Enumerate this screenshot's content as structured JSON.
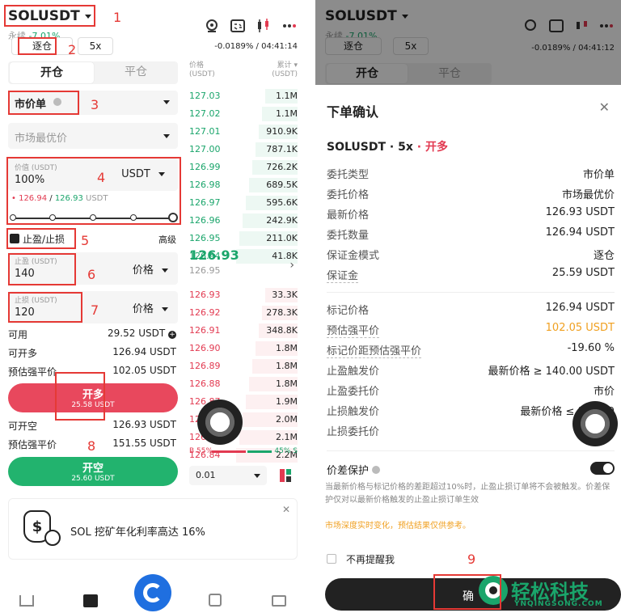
{
  "left": {
    "symbol": "SOLUSDT",
    "contract_type": "永续",
    "change_pct": "-7.01%",
    "funding_label": "资金费率/倒计时",
    "funding_value": "-0.0189% / 04:41:14",
    "margin_mode": "逐仓",
    "leverage": "5x",
    "tab_open": "开仓",
    "tab_close": "平仓",
    "order_type": "市价单",
    "market_best_price": "市场最优价",
    "value_label": "价值 (USDT)",
    "value_amount": "100%",
    "value_unit": "USDT",
    "price_bid": "126.94",
    "price_ask": "126.93",
    "price_suffix": "USDT",
    "tpsl_label": "止盈/止损",
    "advanced_label": "高级",
    "tp_label": "止盈 (USDT)",
    "tp_value": "140",
    "tp_type": "价格",
    "sl_label": "止损 (USDT)",
    "sl_value": "120",
    "sl_type": "价格",
    "available_label": "可用",
    "available_value": "29.52 USDT",
    "can_long_label": "可开多",
    "can_long_value": "126.94 USDT",
    "liq_label": "预估强平价",
    "liq_long_value": "102.05 USDT",
    "open_long_label": "开多",
    "open_long_sub": "25.58 USDT",
    "can_short_label": "可开空",
    "can_short_value": "126.93 USDT",
    "liq_short_value": "151.55 USDT",
    "open_short_label": "开空",
    "open_short_sub": "25.60 USDT",
    "ob_price_header": "价格\n(USDT)",
    "ob_total_header": "累计 ▾\n(USDT)",
    "ob_price_head1": "价格",
    "ob_price_head2": "(USDT)",
    "ob_total_head1": "累计 ▾",
    "ob_total_head2": "(USDT)",
    "asks_green": [
      {
        "price": "127.03",
        "total": "1.1M"
      },
      {
        "price": "127.02",
        "total": "1.1M"
      },
      {
        "price": "127.01",
        "total": "910.9K"
      },
      {
        "price": "127.00",
        "total": "787.1K"
      },
      {
        "price": "126.99",
        "total": "726.2K"
      },
      {
        "price": "126.98",
        "total": "689.5K"
      },
      {
        "price": "126.97",
        "total": "595.6K"
      },
      {
        "price": "126.96",
        "total": "242.9K"
      },
      {
        "price": "126.95",
        "total": "211.0K"
      },
      {
        "price": "126.94",
        "total": "41.8K"
      }
    ],
    "last_price": "126.93",
    "mark_price": "126.95",
    "bids_red": [
      {
        "price": "126.93",
        "total": "33.3K"
      },
      {
        "price": "126.92",
        "total": "278.3K"
      },
      {
        "price": "126.91",
        "total": "348.8K"
      },
      {
        "price": "126.90",
        "total": "1.8M"
      },
      {
        "price": "126.89",
        "total": "1.8M"
      },
      {
        "price": "126.88",
        "total": "1.8M"
      },
      {
        "price": "126.87",
        "total": "1.9M"
      },
      {
        "price": "126.86",
        "total": "2.0M"
      },
      {
        "price": "126.85",
        "total": "2.1M"
      },
      {
        "price": "126.84",
        "total": "2.2M"
      }
    ],
    "ratio_buy": "B 55%",
    "ratio_sell": "45% S",
    "tick_size": "0.01",
    "promo_text": "SOL 挖矿年化利率高达 16%",
    "promo_icon_text": "$"
  },
  "right": {
    "symbol": "SOLUSDT",
    "contract_type": "永续",
    "change_pct": "-7.01%",
    "funding_value": "-0.0189% / 04:41:12",
    "margin_mode": "逐仓",
    "leverage": "5x",
    "tab_open": "开仓",
    "tab_close": "平仓",
    "dialog_title": "下单确认",
    "pair_line": "SOLUSDT · 5x",
    "side_tag": "· 开多",
    "rows_a": [
      {
        "k": "委托类型",
        "v": "市价单"
      },
      {
        "k": "委托价格",
        "v": "市场最优价"
      },
      {
        "k": "最新价格",
        "v": "126.93 USDT"
      },
      {
        "k": "委托数量",
        "v": "126.94 USDT"
      },
      {
        "k": "保证金模式",
        "v": "逐仓"
      },
      {
        "k": "保证金",
        "v": "25.59 USDT"
      }
    ],
    "rows_b": [
      {
        "k": "标记价格",
        "v": "126.94 USDT"
      },
      {
        "k": "预估强平价",
        "v": "102.05 USDT"
      },
      {
        "k": "标记价距预估强平价",
        "v": "-19.60 %"
      },
      {
        "k": "止盈触发价",
        "v": "最新价格 ≥ 140.00 USDT"
      },
      {
        "k": "止盈委托价",
        "v": "市价"
      },
      {
        "k": "止损触发价",
        "v": "最新价格 ≤ 120.00"
      },
      {
        "k": "止损委托价",
        "v": ""
      }
    ],
    "spread_protect": "价差保护",
    "spread_note": "当最新价格与标记价格的差距超过10%时，止盈止损订单将不会被触发。价差保护仅对以最新价格触发的止盈止损订单生效",
    "warn_note": "市场深度实时变化，预估结果仅供参考。",
    "no_remind": "不再提醒我",
    "confirm_label": "确",
    "brand_name": "轻松科技",
    "brand_url": "YNQINGSONG.COM"
  },
  "annotations": [
    "1",
    "2",
    "3",
    "4",
    "5",
    "6",
    "7",
    "8",
    "9"
  ],
  "colors": {
    "green": "#1aa56b",
    "red": "#e23a51",
    "accent_orange": "#f0a020",
    "brand_blue": "#1f6fe0"
  }
}
